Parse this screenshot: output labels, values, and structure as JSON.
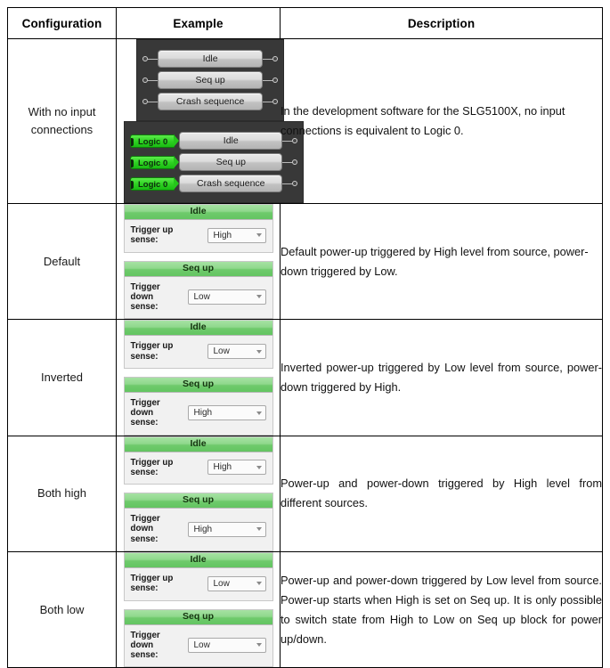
{
  "table": {
    "headers": [
      "Configuration",
      "Example",
      "Description"
    ],
    "rows": [
      {
        "config": "With no input connections",
        "example_type": "schematic",
        "schematics": [
          {
            "id": "schematic-no-inputs",
            "has_logic_tags": false,
            "blocks": [
              "Idle",
              "Seq up",
              "Crash sequence"
            ]
          },
          {
            "id": "schematic-logic0-inputs",
            "has_logic_tags": true,
            "logic_tag_label": "Logic 0",
            "blocks": [
              "Idle",
              "Seq up",
              "Crash sequence"
            ]
          }
        ],
        "description": "In the development software for the SLG5100X, no input connections is equivalent to Logic 0.",
        "description_justified": false
      },
      {
        "config": "Default",
        "example_type": "widgets",
        "widgets": [
          {
            "header": "Idle",
            "label": "Trigger up sense:",
            "value": "High",
            "label_lines": 1
          },
          {
            "header": "Seq up",
            "label": "Trigger down sense:",
            "value": "Low",
            "label_lines": 2
          }
        ],
        "description": "Default power-up triggered by High level from source, power-down triggered by Low.",
        "description_justified": false
      },
      {
        "config": "Inverted",
        "example_type": "widgets",
        "widgets": [
          {
            "header": "Idle",
            "label": "Trigger up sense:",
            "value": "Low",
            "label_lines": 1
          },
          {
            "header": "Seq up",
            "label": "Trigger down sense:",
            "value": "High",
            "label_lines": 2
          }
        ],
        "description": "Inverted power-up triggered by Low level from source, power-down triggered by High.",
        "description_justified": true
      },
      {
        "config": "Both high",
        "example_type": "widgets",
        "widgets": [
          {
            "header": "Idle",
            "label": "Trigger up sense:",
            "value": "High",
            "label_lines": 1
          },
          {
            "header": "Seq up",
            "label": "Trigger down sense:",
            "value": "High",
            "label_lines": 2
          }
        ],
        "description": "Power-up and power-down triggered by High level from different sources.",
        "description_justified": true
      },
      {
        "config": "Both low",
        "example_type": "widgets",
        "widgets": [
          {
            "header": "Idle",
            "label": "Trigger up sense:",
            "value": "Low",
            "label_lines": 1
          },
          {
            "header": "Seq up",
            "label": "Trigger down sense:",
            "value": "Low",
            "label_lines": 2
          }
        ],
        "description": "Power-up and power-down triggered by Low level from source. Power-up starts when High is set on Seq up. It is only possible to switch state from High to Low on Seq up block for power up/down.",
        "description_justified": true
      }
    ]
  },
  "colors": {
    "widget_header_green": "#8fd88c",
    "logic_tag_green": "#2fd223",
    "schematic_background": "#383838",
    "table_border": "#000000"
  }
}
